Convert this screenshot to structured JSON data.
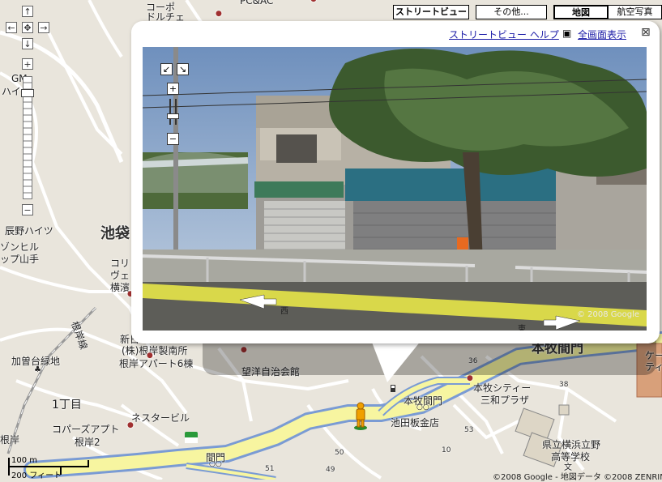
{
  "map_type_buttons": {
    "streetview": "ストリートビュー",
    "more": "その他...",
    "map": "地図",
    "satellite": "航空写真"
  },
  "nav_controls": {
    "pan_up": "↑",
    "pan_left": "←",
    "pan_center": "✥",
    "pan_right": "→",
    "pan_down": "↓",
    "zoom_in": "+",
    "zoom_out": "−"
  },
  "street_view": {
    "help_link": "ストリートビュー ヘルプ",
    "fullscreen_link": "全画面表示",
    "close_label": "⊠",
    "pano_zoom_in": "+",
    "pano_zoom_out": "−",
    "direction_west": "西",
    "direction_east": "東",
    "pano_copyright": "© 2008 Google"
  },
  "map_labels": {
    "koopo": "コーポ",
    "dolce": "ドルチェ",
    "pcac": "PC&AC",
    "gm": "GM",
    "haitsu_te": "ハイ   手",
    "tatsuno_heights": "辰野ハイツ",
    "zon_hill": "ゾンヒル",
    "yamate": "ップ山手",
    "ikebukuro": "池袋",
    "kori": "コリ",
    "ve": "ヴェ",
    "yokohama": "横濱",
    "negishi_sen": "根岸線",
    "shin": "新日",
    "negishi_seisakusho": "(株)根岸製南所",
    "negishi_apart": "根岸アパート6棟",
    "kasone_ryokuchi": "加曽台緑地",
    "choume_1": "1丁目",
    "nestar_building": "ネスタービル",
    "cowpers_apart": "コパーズアプト",
    "negishi_2": "根岸2",
    "negishi": "根岸",
    "mamon": "間門",
    "boyo_jichikaikan": "望洋自治会館",
    "honmoku_mamon": "本牧間門",
    "honmoku_city": "本牧シティー",
    "sanwa_plaza": "三和プラザ",
    "ikeda_bankinten": "池田板金店",
    "honmoku_mamon_big": "本牧間門",
    "kenritsu": "県立横浜立野",
    "koto_gakko": "高等学校",
    "ke": "ケー",
    "tei": "ティ",
    "num_36": "36",
    "num_53": "53",
    "num_50": "50",
    "num_49": "49",
    "num_51": "51",
    "num_10": "10",
    "num_38": "38"
  },
  "scale": {
    "metric": "100 m",
    "imperial": "200 フィート"
  },
  "copyright": "©2008 Google - 地図データ ©2008 ZENRIN",
  "colors": {
    "road_yellow": "#f7f5a0",
    "road_blue": "#7a9bd4",
    "map_bg": "#e9e5dc",
    "link_blue": "#1a1aa6"
  }
}
